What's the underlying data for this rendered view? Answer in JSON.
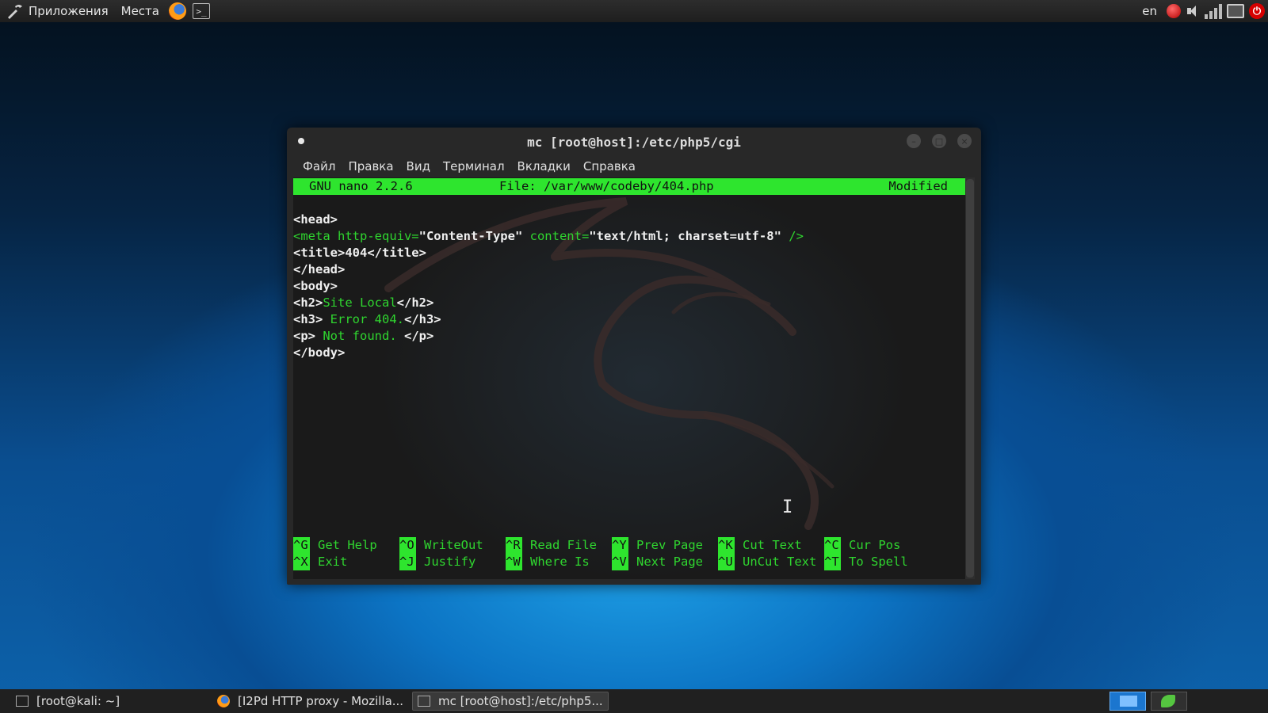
{
  "top_panel": {
    "apps_label": "Приложения",
    "places_label": "Места",
    "lang": "en"
  },
  "window": {
    "title": "mc [root@host]:/etc/php5/cgi",
    "menu": [
      "Файл",
      "Правка",
      "Вид",
      "Терминал",
      "Вкладки",
      "Справка"
    ]
  },
  "nano": {
    "version": "GNU nano 2.2.6",
    "file": "File: /var/www/codeby/404.php",
    "status": "Modified",
    "lines": {
      "l1": "<head>",
      "l2a": "<meta http-equiv=",
      "l2b": "\"Content-Type\"",
      "l2c": " content=",
      "l2d": "\"text/html; charset=utf-8\"",
      "l2e": " />",
      "l3": "<title>404</title>",
      "l4": "</head>",
      "l5": "<body>",
      "l6a": "<h2>",
      "l6b": "Site Local",
      "l6c": "</h2>",
      "l7a": "<h3>",
      "l7b": " Error 404.",
      "l7c": "</h3>",
      "l8a": "<p>",
      "l8b": " Not found. ",
      "l8c": "</p>",
      "l9": "</body>"
    },
    "shortcuts": [
      {
        "key": "^G",
        "label": "Get Help"
      },
      {
        "key": "^O",
        "label": "WriteOut"
      },
      {
        "key": "^R",
        "label": "Read File"
      },
      {
        "key": "^Y",
        "label": "Prev Page"
      },
      {
        "key": "^K",
        "label": "Cut Text"
      },
      {
        "key": "^C",
        "label": "Cur Pos"
      },
      {
        "key": "^X",
        "label": "Exit"
      },
      {
        "key": "^J",
        "label": "Justify"
      },
      {
        "key": "^W",
        "label": "Where Is"
      },
      {
        "key": "^V",
        "label": "Next Page"
      },
      {
        "key": "^U",
        "label": "UnCut Text"
      },
      {
        "key": "^T",
        "label": "To Spell"
      }
    ]
  },
  "taskbar": {
    "tasks": [
      "[root@kali: ~]",
      "[I2Pd HTTP proxy - Mozilla...",
      "mc [root@host]:/etc/php5..."
    ]
  },
  "colors": {
    "nano_green": "#2ee52e",
    "terminal_bg": "#1a1a1a",
    "desktop_blue": "#0d62ab"
  },
  "icons": [
    "kali-menu-icon",
    "firefox-icon",
    "terminal-icon",
    "record-icon",
    "volume-icon",
    "signal-icon",
    "battery-icon",
    "power-icon"
  ]
}
